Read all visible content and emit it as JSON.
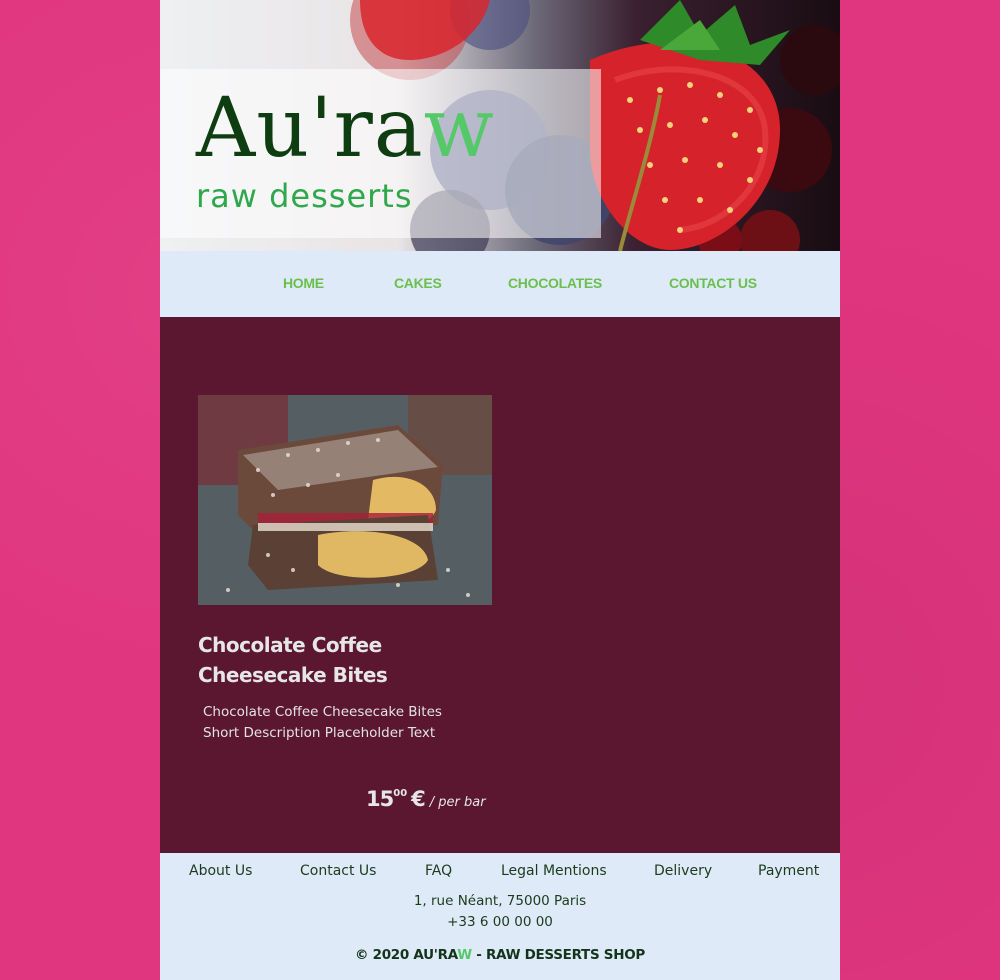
{
  "header": {
    "logo_main": "Au'ra",
    "logo_w": "w",
    "tagline": "raw desserts"
  },
  "nav": {
    "items": [
      {
        "label": "HOME"
      },
      {
        "label": "CAKES"
      },
      {
        "label": "CHOCOLATES"
      },
      {
        "label": "CONTACT US"
      }
    ]
  },
  "product": {
    "image": "chocolate coffee cheesecake bites photo",
    "title": "Chocolate Coffee Cheesecake Bites",
    "description_line1": "Chocolate Coffee Cheesecake Bites",
    "description_line2": "Short Description Placeholder Text",
    "price_int": "15",
    "price_dec": "00",
    "currency": "€",
    "unit": "/ per bar"
  },
  "footer": {
    "links": [
      {
        "label": "About Us"
      },
      {
        "label": "Contact Us"
      },
      {
        "label": "FAQ"
      },
      {
        "label": "Legal Mentions"
      },
      {
        "label": "Delivery"
      },
      {
        "label": "Payment"
      }
    ],
    "address_line1": "1, rue Néant, 75000 Paris",
    "phone": "+33 6 00 00 00",
    "copyright_prefix": "© 2020 AU'RA",
    "copyright_w": "W",
    "copyright_suffix": " - RAW DESSERTS SHOP"
  },
  "colors": {
    "page_background": "#e0357f",
    "main_background": "#5b1730",
    "nav_background": "#deeaf8",
    "nav_text": "#6bbf4e",
    "logo_dark_green": "#0f3d12",
    "logo_light_green": "#55c96a",
    "tagline_green": "#2fa84b"
  }
}
